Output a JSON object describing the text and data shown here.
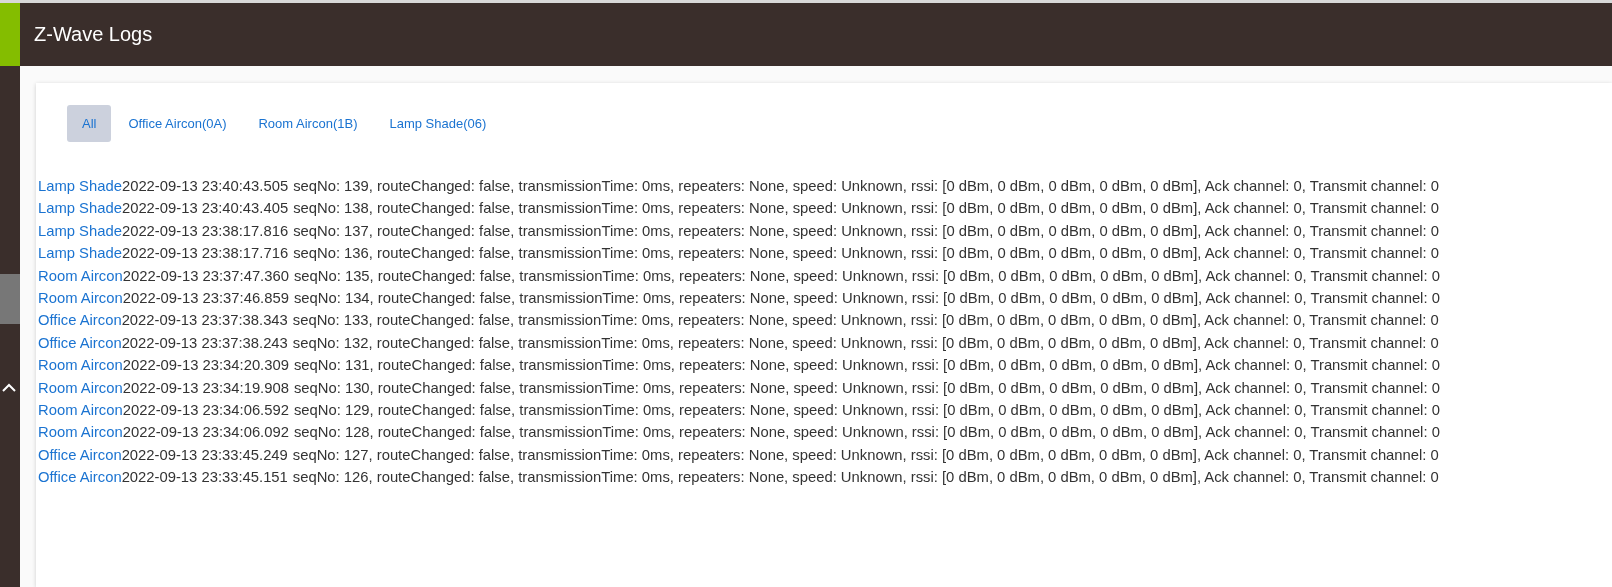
{
  "header": {
    "title": "Z-Wave Logs"
  },
  "tabs": [
    {
      "label": "All",
      "selected": true
    },
    {
      "label": "Office Aircon(0A)",
      "selected": false
    },
    {
      "label": "Room Aircon(1B)",
      "selected": false
    },
    {
      "label": "Lamp Shade(06)",
      "selected": false
    }
  ],
  "logs": [
    {
      "device": "Lamp Shade",
      "timestamp": "2022-09-13 23:40:43.505",
      "message": "seqNo: 139, routeChanged: false, transmissionTime: 0ms, repeaters: None, speed: Unknown, rssi: [0 dBm, 0 dBm, 0 dBm, 0 dBm, 0 dBm], Ack channel: 0, Transmit channel: 0"
    },
    {
      "device": "Lamp Shade",
      "timestamp": "2022-09-13 23:40:43.405",
      "message": "seqNo: 138, routeChanged: false, transmissionTime: 0ms, repeaters: None, speed: Unknown, rssi: [0 dBm, 0 dBm, 0 dBm, 0 dBm, 0 dBm], Ack channel: 0, Transmit channel: 0"
    },
    {
      "device": "Lamp Shade",
      "timestamp": "2022-09-13 23:38:17.816",
      "message": "seqNo: 137, routeChanged: false, transmissionTime: 0ms, repeaters: None, speed: Unknown, rssi: [0 dBm, 0 dBm, 0 dBm, 0 dBm, 0 dBm], Ack channel: 0, Transmit channel: 0"
    },
    {
      "device": "Lamp Shade",
      "timestamp": "2022-09-13 23:38:17.716",
      "message": "seqNo: 136, routeChanged: false, transmissionTime: 0ms, repeaters: None, speed: Unknown, rssi: [0 dBm, 0 dBm, 0 dBm, 0 dBm, 0 dBm], Ack channel: 0, Transmit channel: 0"
    },
    {
      "device": "Room Aircon",
      "timestamp": "2022-09-13 23:37:47.360",
      "message": "seqNo: 135, routeChanged: false, transmissionTime: 0ms, repeaters: None, speed: Unknown, rssi: [0 dBm, 0 dBm, 0 dBm, 0 dBm, 0 dBm], Ack channel: 0, Transmit channel: 0"
    },
    {
      "device": "Room Aircon",
      "timestamp": "2022-09-13 23:37:46.859",
      "message": "seqNo: 134, routeChanged: false, transmissionTime: 0ms, repeaters: None, speed: Unknown, rssi: [0 dBm, 0 dBm, 0 dBm, 0 dBm, 0 dBm], Ack channel: 0, Transmit channel: 0"
    },
    {
      "device": "Office Aircon",
      "timestamp": "2022-09-13 23:37:38.343",
      "message": "seqNo: 133, routeChanged: false, transmissionTime: 0ms, repeaters: None, speed: Unknown, rssi: [0 dBm, 0 dBm, 0 dBm, 0 dBm, 0 dBm], Ack channel: 0, Transmit channel: 0"
    },
    {
      "device": "Office Aircon",
      "timestamp": "2022-09-13 23:37:38.243",
      "message": "seqNo: 132, routeChanged: false, transmissionTime: 0ms, repeaters: None, speed: Unknown, rssi: [0 dBm, 0 dBm, 0 dBm, 0 dBm, 0 dBm], Ack channel: 0, Transmit channel: 0"
    },
    {
      "device": "Room Aircon",
      "timestamp": "2022-09-13 23:34:20.309",
      "message": "seqNo: 131, routeChanged: false, transmissionTime: 0ms, repeaters: None, speed: Unknown, rssi: [0 dBm, 0 dBm, 0 dBm, 0 dBm, 0 dBm], Ack channel: 0, Transmit channel: 0"
    },
    {
      "device": "Room Aircon",
      "timestamp": "2022-09-13 23:34:19.908",
      "message": "seqNo: 130, routeChanged: false, transmissionTime: 0ms, repeaters: None, speed: Unknown, rssi: [0 dBm, 0 dBm, 0 dBm, 0 dBm, 0 dBm], Ack channel: 0, Transmit channel: 0"
    },
    {
      "device": "Room Aircon",
      "timestamp": "2022-09-13 23:34:06.592",
      "message": "seqNo: 129, routeChanged: false, transmissionTime: 0ms, repeaters: None, speed: Unknown, rssi: [0 dBm, 0 dBm, 0 dBm, 0 dBm, 0 dBm], Ack channel: 0, Transmit channel: 0"
    },
    {
      "device": "Room Aircon",
      "timestamp": "2022-09-13 23:34:06.092",
      "message": "seqNo: 128, routeChanged: false, transmissionTime: 0ms, repeaters: None, speed: Unknown, rssi: [0 dBm, 0 dBm, 0 dBm, 0 dBm, 0 dBm], Ack channel: 0, Transmit channel: 0"
    },
    {
      "device": "Office Aircon",
      "timestamp": "2022-09-13 23:33:45.249",
      "message": "seqNo: 127, routeChanged: false, transmissionTime: 0ms, repeaters: None, speed: Unknown, rssi: [0 dBm, 0 dBm, 0 dBm, 0 dBm, 0 dBm], Ack channel: 0, Transmit channel: 0"
    },
    {
      "device": "Office Aircon",
      "timestamp": "2022-09-13 23:33:45.151",
      "message": "seqNo: 126, routeChanged: false, transmissionTime: 0ms, repeaters: None, speed: Unknown, rssi: [0 dBm, 0 dBm, 0 dBm, 0 dBm, 0 dBm], Ack channel: 0, Transmit channel: 0"
    }
  ]
}
